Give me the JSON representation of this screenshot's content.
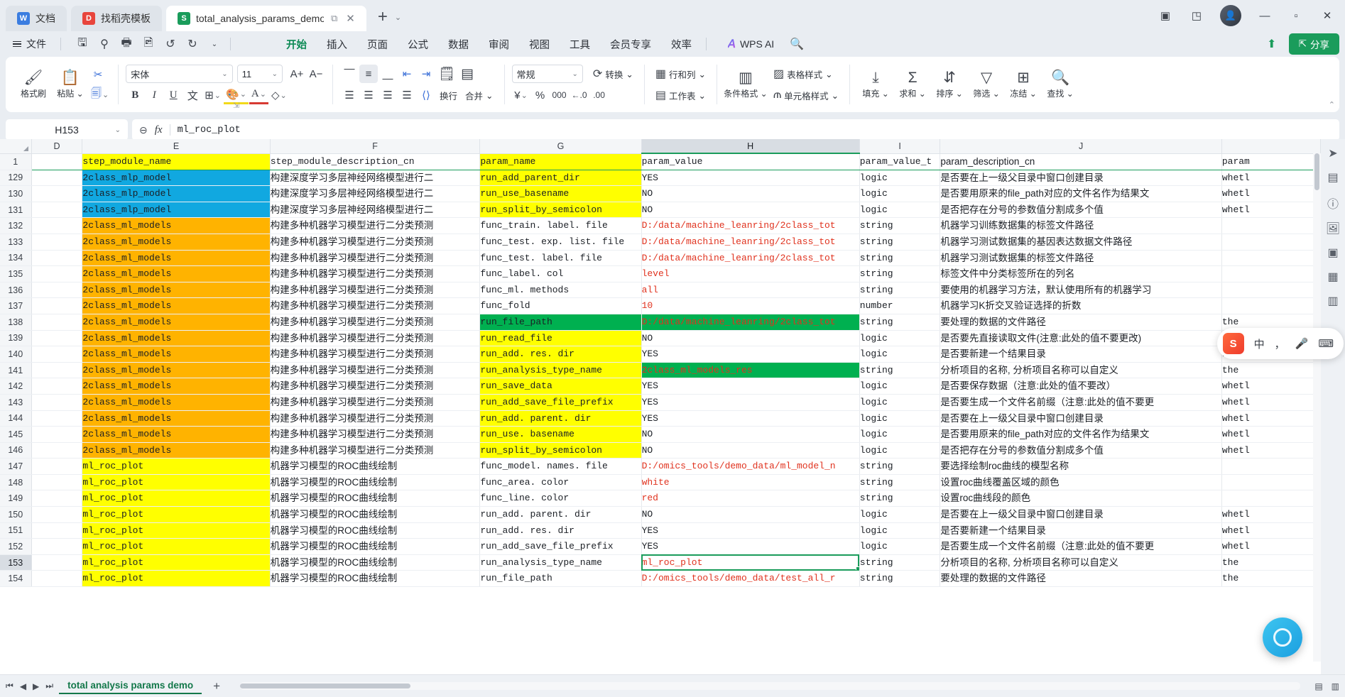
{
  "window": {
    "tabs": [
      {
        "label": "文档",
        "icon": "doc-icon",
        "active": false
      },
      {
        "label": "找稻壳模板",
        "icon": "template-icon",
        "active": false
      },
      {
        "label": "total_analysis_params_demo",
        "icon": "sheet-icon",
        "active": true
      }
    ],
    "new_tab": "+",
    "new_tab_chevron": "⌄",
    "tab_restore_icon": "⧉",
    "tab_close_icon": "✕",
    "controls": {
      "minimize": "—",
      "maximize": "▫",
      "close": "✕",
      "grid": "▣",
      "box": "◳"
    }
  },
  "menu": {
    "file_label": "文件",
    "quick_access": [
      "save-icon",
      "cloud-sync-icon",
      "print-icon",
      "print-preview-icon",
      "undo-icon",
      "redo-icon",
      "more-chevron-icon"
    ],
    "tabs": [
      "开始",
      "插入",
      "页面",
      "公式",
      "数据",
      "审阅",
      "视图",
      "工具",
      "会员专享",
      "效率"
    ],
    "active_tab": "开始",
    "wps_ai": "WPS AI",
    "search_icon": "search-icon",
    "share_label": "分享",
    "upload_icon": "upload-icon"
  },
  "ribbon": {
    "clipboard": {
      "format_painter": "格式刷",
      "paste": "粘贴",
      "copy": "复制",
      "cut_icon": "scissors-icon",
      "paste_icon": "clipboard-icon",
      "painter_icon": "brush-icon",
      "copy_icon": "copy-icon"
    },
    "font": {
      "family": "宋体",
      "size": "11",
      "grow": "A+",
      "shrink": "A−",
      "bold": "B",
      "italic": "I",
      "underline": "U",
      "strike_icon": "pinyin-icon",
      "border_icon": "borders-icon",
      "fill_icon": "fill-color-icon",
      "fontcolor_icon": "font-color-icon",
      "clear_icon": "clear-format-icon"
    },
    "alignment": {
      "align_top_icon": "align-top-icon",
      "align_middle_icon": "align-middle-icon",
      "align_bottom_icon": "align-bottom-icon",
      "decrease_indent_icon": "decrease-indent-icon",
      "increase_indent_icon": "increase-indent-icon",
      "wrap_label": "换行",
      "merge_label": "合并",
      "align_left_icon": "align-left-icon",
      "align_center_icon": "align-center-icon",
      "align_right_icon": "align-right-icon",
      "justify_icon": "justify-icon",
      "orientation_icon": "text-orientation-icon",
      "wrap_icon": "wrap-text-icon",
      "merge_icon": "merge-cells-icon"
    },
    "number": {
      "format": "常规",
      "convert_label": "转换",
      "currency_icon": "currency-icon",
      "percent_icon": "percent-icon",
      "comma_icon": "comma-icon",
      "dec_decrease_icon": "decrease-decimal-icon",
      "dec_increase_icon": "increase-decimal-icon",
      "convert_icon": "convert-icon"
    },
    "cells": {
      "rows_cols": "行和列",
      "worksheet": "工作表",
      "conditional_format": "条件格式",
      "table_style": "表格样式",
      "cell_style": "单元格样式",
      "rows_cols_icon": "rows-columns-icon",
      "worksheet_icon": "worksheet-icon",
      "conditional_icon": "conditional-format-icon",
      "table_style_icon": "table-style-icon",
      "cell_style_icon": "cell-style-icon"
    },
    "editing": {
      "fill": "填充",
      "sum": "求和",
      "sort": "排序",
      "filter": "筛选",
      "freeze": "冻结",
      "find": "查找",
      "fill_icon": "fill-down-icon",
      "sum_icon": "autosum-icon",
      "sort_icon": "sort-icon",
      "filter_icon": "filter-icon",
      "freeze_icon": "freeze-panes-icon",
      "find_icon": "find-icon"
    }
  },
  "formula_bar": {
    "name_box": "H153",
    "name_box_chevron": "⌄",
    "zoom_icon": "zoom-out-icon",
    "fx_label": "fx",
    "value": "ml_roc_plot"
  },
  "grid": {
    "columns": [
      "D",
      "E",
      "F",
      "G",
      "H",
      "I",
      "J",
      ""
    ],
    "selected_column": "H",
    "selected_row": "153",
    "selected_cell": "H153",
    "header_row_number": "1",
    "header_row": {
      "D": "",
      "E": "step_module_name",
      "F": "step_module_description_cn",
      "G": "param_name",
      "H": "param_value",
      "I": "param_value_t",
      "J": "param_description_cn",
      "K": "param"
    },
    "rows": [
      {
        "n": "129",
        "E": "2class_mlp_model",
        "E_bg": "#11a8e0",
        "F": "构建深度学习多层神经网络模型进行二",
        "G": "run_add_parent_dir",
        "G_bg": "#ffff00",
        "H": "YES",
        "I": "logic",
        "J": "是否要在上一级父目录中窗口创建目录",
        "K": "whetl"
      },
      {
        "n": "130",
        "E": "2class_mlp_model",
        "E_bg": "#11a8e0",
        "F": "构建深度学习多层神经网络模型进行二",
        "G": "run_use_basename",
        "G_bg": "#ffff00",
        "H": "NO",
        "I": "logic",
        "J": "是否要用原来的file_path对应的文件名作为结果文",
        "K": "whetl"
      },
      {
        "n": "131",
        "E": "2class_mlp_model",
        "E_bg": "#11a8e0",
        "F": "构建深度学习多层神经网络模型进行二",
        "G": "run_split_by_semicolon",
        "G_bg": "#ffff00",
        "H": "NO",
        "I": "logic",
        "J": "是否把存在分号的参数值分割成多个值",
        "K": "whetl"
      },
      {
        "n": "132",
        "E": "2class_ml_models",
        "E_bg": "#ffb300",
        "F": "构建多种机器学习模型进行二分类预测",
        "G": "func_train. label. file",
        "H": "D:/data/machine_leanring/2class_tot",
        "H_fg": "#e0321e",
        "I": "string",
        "J": "机器学习训练数据集的标签文件路径",
        "K": ""
      },
      {
        "n": "133",
        "E": "2class_ml_models",
        "E_bg": "#ffb300",
        "F": "构建多种机器学习模型进行二分类预测",
        "G": "func_test. exp. list. file",
        "H": "D:/data/machine_leanring/2class_tot",
        "H_fg": "#e0321e",
        "I": "string",
        "J": "机器学习测试数据集的基因表达数据文件路径",
        "K": ""
      },
      {
        "n": "134",
        "E": "2class_ml_models",
        "E_bg": "#ffb300",
        "F": "构建多种机器学习模型进行二分类预测",
        "G": "func_test. label. file",
        "H": "D:/data/machine_leanring/2class_tot",
        "H_fg": "#e0321e",
        "I": "string",
        "J": "机器学习测试数据集的标签文件路径",
        "K": ""
      },
      {
        "n": "135",
        "E": "2class_ml_models",
        "E_bg": "#ffb300",
        "F": "构建多种机器学习模型进行二分类预测",
        "G": "func_label. col",
        "H": "level",
        "H_fg": "#e0321e",
        "I": "string",
        "J": "标签文件中分类标签所在的列名",
        "K": ""
      },
      {
        "n": "136",
        "E": "2class_ml_models",
        "E_bg": "#ffb300",
        "F": "构建多种机器学习模型进行二分类预测",
        "G": "func_ml. methods",
        "H": "all",
        "H_fg": "#e0321e",
        "I": "string",
        "J": "要使用的机器学习方法，默认使用所有的机器学习",
        "K": ""
      },
      {
        "n": "137",
        "E": "2class_ml_models",
        "E_bg": "#ffb300",
        "F": "构建多种机器学习模型进行二分类预测",
        "G": "func_fold",
        "H": "10",
        "H_fg": "#e0321e",
        "I": "number",
        "J": "机器学习K折交叉验证选择的折数",
        "K": ""
      },
      {
        "n": "138",
        "E": "2class_ml_models",
        "E_bg": "#ffb300",
        "F": "构建多种机器学习模型进行二分类预测",
        "G": "run_file_path",
        "G_bg": "#00b050",
        "H": "D:/data/machine_leanring/2class_tot",
        "H_bg": "#00b050",
        "H_fg": "#e0321e",
        "I": "string",
        "J": "要处理的数据的文件路径",
        "K": "the "
      },
      {
        "n": "139",
        "E": "2class_ml_models",
        "E_bg": "#ffb300",
        "F": "构建多种机器学习模型进行二分类预测",
        "G": "run_read_file",
        "G_bg": "#ffff00",
        "H": "NO",
        "I": "logic",
        "J": "是否要先直接读取文件(注意:此处的值不要更改)",
        "K": "whetl"
      },
      {
        "n": "140",
        "E": "2class_ml_models",
        "E_bg": "#ffb300",
        "F": "构建多种机器学习模型进行二分类预测",
        "G": "run_add. res. dir",
        "G_bg": "#ffff00",
        "H": "YES",
        "I": "logic",
        "J": "是否要新建一个结果目录",
        "K": "whetl"
      },
      {
        "n": "141",
        "E": "2class_ml_models",
        "E_bg": "#ffb300",
        "F": "构建多种机器学习模型进行二分类预测",
        "G": "run_analysis_type_name",
        "G_bg": "#ffff00",
        "H": "2class_ml_models_res",
        "H_bg": "#00b050",
        "H_fg": "#e0321e",
        "I": "string",
        "J": "分析项目的名称, 分析项目名称可以自定义",
        "K": "the "
      },
      {
        "n": "142",
        "E": "2class_ml_models",
        "E_bg": "#ffb300",
        "F": "构建多种机器学习模型进行二分类预测",
        "G": "run_save_data",
        "G_bg": "#ffff00",
        "H": "YES",
        "I": "logic",
        "J": "是否要保存数据（注意:此处的值不要改）",
        "K": "whetl"
      },
      {
        "n": "143",
        "E": "2class_ml_models",
        "E_bg": "#ffb300",
        "F": "构建多种机器学习模型进行二分类预测",
        "G": "run_add_save_file_prefix",
        "G_bg": "#ffff00",
        "H": "YES",
        "I": "logic",
        "J": "是否要生成一个文件名前缀（注意:此处的值不要更",
        "K": "whetl"
      },
      {
        "n": "144",
        "E": "2class_ml_models",
        "E_bg": "#ffb300",
        "F": "构建多种机器学习模型进行二分类预测",
        "G": "run_add. parent. dir",
        "G_bg": "#ffff00",
        "H": "YES",
        "I": "logic",
        "J": "是否要在上一级父目录中窗口创建目录",
        "K": "whetl"
      },
      {
        "n": "145",
        "E": "2class_ml_models",
        "E_bg": "#ffb300",
        "F": "构建多种机器学习模型进行二分类预测",
        "G": "run_use. basename",
        "G_bg": "#ffff00",
        "H": "NO",
        "I": "logic",
        "J": "是否要用原来的file_path对应的文件名作为结果文",
        "K": "whetl"
      },
      {
        "n": "146",
        "E": "2class_ml_models",
        "E_bg": "#ffb300",
        "F": "构建多种机器学习模型进行二分类预测",
        "G": "run_split_by_semicolon",
        "G_bg": "#ffff00",
        "H": "NO",
        "I": "logic",
        "J": "是否把存在分号的参数值分割成多个值",
        "K": "whetl"
      },
      {
        "n": "147",
        "E": "ml_roc_plot",
        "E_bg": "#ffff00",
        "F": "机器学习模型的ROC曲线绘制",
        "G": "func_model. names. file",
        "H": "D:/omics_tools/demo_data/ml_model_n",
        "H_fg": "#e0321e",
        "I": "string",
        "J": "要选择绘制roc曲线的模型名称",
        "K": ""
      },
      {
        "n": "148",
        "E": "ml_roc_plot",
        "E_bg": "#ffff00",
        "F": "机器学习模型的ROC曲线绘制",
        "G": "func_area. color",
        "H": "white",
        "H_fg": "#e0321e",
        "I": "string",
        "J": "设置roc曲线覆盖区域的颜色",
        "K": ""
      },
      {
        "n": "149",
        "E": "ml_roc_plot",
        "E_bg": "#ffff00",
        "F": "机器学习模型的ROC曲线绘制",
        "G": "func_line. color",
        "H": "red",
        "H_fg": "#e0321e",
        "I": "string",
        "J": "设置roc曲线段的颜色",
        "K": ""
      },
      {
        "n": "150",
        "E": "ml_roc_plot",
        "E_bg": "#ffff00",
        "F": "机器学习模型的ROC曲线绘制",
        "G": "run_add. parent. dir",
        "H": "NO",
        "I": "logic",
        "J": "是否要在上一级父目录中窗口创建目录",
        "K": "whetl"
      },
      {
        "n": "151",
        "E": "ml_roc_plot",
        "E_bg": "#ffff00",
        "F": "机器学习模型的ROC曲线绘制",
        "G": "run_add. res. dir",
        "H": "YES",
        "I": "logic",
        "J": "是否要新建一个结果目录",
        "K": "whetl"
      },
      {
        "n": "152",
        "E": "ml_roc_plot",
        "E_bg": "#ffff00",
        "F": "机器学习模型的ROC曲线绘制",
        "G": "run_add_save_file_prefix",
        "H": "YES",
        "I": "logic",
        "J": "是否要生成一个文件名前缀（注意:此处的值不要更",
        "K": "whetl"
      },
      {
        "n": "153",
        "E": "ml_roc_plot",
        "E_bg": "#ffff00",
        "F": "机器学习模型的ROC曲线绘制",
        "G": "run_analysis_type_name",
        "H": "ml_roc_plot",
        "H_fg": "#e0321e",
        "H_sel": true,
        "I": "string",
        "J": "分析项目的名称, 分析项目名称可以自定义",
        "K": "the "
      },
      {
        "n": "154",
        "E": "ml_roc_plot",
        "E_bg": "#ffff00",
        "F": "机器学习模型的ROC曲线绘制",
        "G": "run_file_path",
        "H": "D:/omics_tools/demo_data/test_all_r",
        "H_fg": "#e0321e",
        "I": "string",
        "J": "要处理的数据的文件路径",
        "K": "the "
      }
    ]
  },
  "sidebar_right": {
    "icons": [
      "cursor-icon",
      "comment-icon",
      "question-icon",
      "image-icon",
      "shape-icon",
      "chart-icon",
      "more-icon"
    ]
  },
  "bottom": {
    "first_icon": "first-sheet-icon",
    "prev_icon": "prev-sheet-icon",
    "next_icon": "next-sheet-icon",
    "last_icon": "last-sheet-icon",
    "sheet_name": "total analysis params demo",
    "add_sheet": "+"
  },
  "ime": {
    "logo": "S",
    "mode": "中",
    "punct_icon": "punctuation-icon",
    "mic_icon": "microphone-icon",
    "keyboard_icon": "keyboard-icon"
  },
  "colors": {
    "accent_green": "#1a9c5b",
    "yellow": "#ffff00",
    "orange": "#ffb300",
    "blue": "#11a8e0",
    "green": "#00b050",
    "red_text": "#e0321e"
  }
}
